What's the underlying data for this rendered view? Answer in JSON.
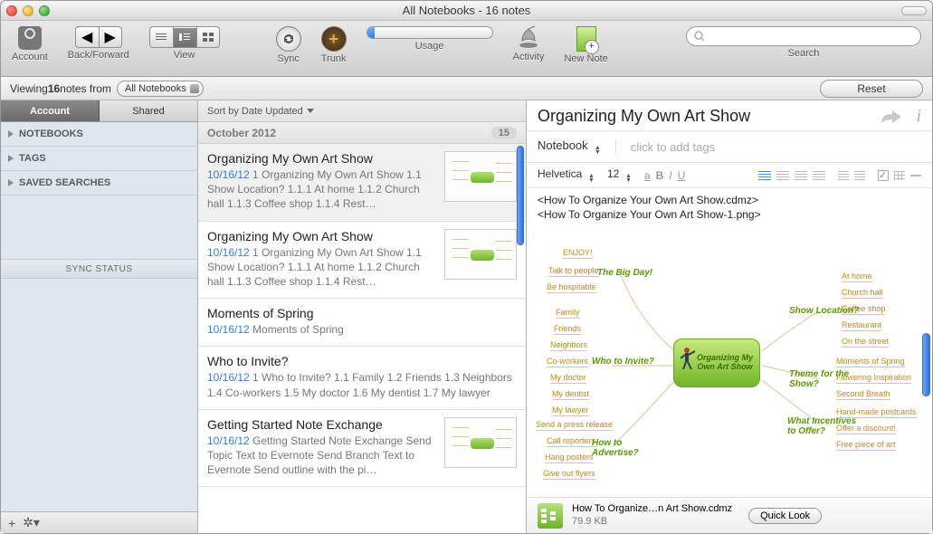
{
  "window": {
    "title": "All Notebooks - 16 notes"
  },
  "toolbar": {
    "account": "Account",
    "backforward": "Back/Forward",
    "view": "View",
    "sync": "Sync",
    "trunk": "Trunk",
    "usage": "Usage",
    "activity": "Activity",
    "newnote": "New Note",
    "search": "Search"
  },
  "filter": {
    "prefix": "Viewing ",
    "count": "16",
    "mid": " notes from ",
    "combo": "All Notebooks",
    "reset": "Reset"
  },
  "sidebar": {
    "tab_account": "Account",
    "tab_shared": "Shared",
    "sections": [
      "NOTEBOOKS",
      "TAGS",
      "SAVED SEARCHES"
    ],
    "sync_status": "SYNC STATUS"
  },
  "list": {
    "sort": "Sort by Date Updated",
    "month": "October 2012",
    "month_count": "15",
    "items": [
      {
        "title": "Organizing My Own Art Show",
        "date": "10/16/12",
        "snippet": "1 Organizing My Own Art Show 1.1 Show Location? 1.1.1 At home 1.1.2 Church hall 1.1.3 Coffee shop 1.1.4 Rest…",
        "thumb": true
      },
      {
        "title": "Organizing My Own Art Show",
        "date": "10/16/12",
        "snippet": "1 Organizing My Own Art Show 1.1 Show Location? 1.1.1 At home 1.1.2 Church hall 1.1.3 Coffee shop 1.1.4 Rest…",
        "thumb": true
      },
      {
        "title": "Moments of Spring",
        "date": "10/16/12",
        "snippet": "Moments of Spring",
        "thumb": false
      },
      {
        "title": "Who to Invite?",
        "date": "10/16/12",
        "snippet": "1 Who to Invite? 1.1 Family 1.2 Friends 1.3 Neighbors 1.4 Co-workers 1.5 My doctor 1.6 My dentist 1.7 My lawyer",
        "thumb": false
      },
      {
        "title": "Getting Started Note Exchange",
        "date": "10/16/12",
        "snippet": "Getting Started Note Exchange Send Topic Text to Evernote Send Branch Text to Evernote Send outline with the pi…",
        "thumb": true
      }
    ]
  },
  "note": {
    "title": "Organizing My Own Art Show",
    "notebook_label": "Notebook",
    "tags_placeholder": "click to add tags",
    "font": "Helvetica",
    "size": "12",
    "file1": "<How To Organize Your Own Art Show.cdmz>",
    "file2": "<How To Organize Your Own Art Show-1.png>",
    "mindmap": {
      "center": "Organizing My Own Art Show",
      "branches": {
        "bigday": {
          "label": "The Big Day!",
          "leaves": [
            "ENJOY!",
            "Talk to people",
            "Be hospitable"
          ]
        },
        "invite": {
          "label": "Who to Invite?",
          "leaves": [
            "Family",
            "Friends",
            "Neighbors",
            "Co-workers",
            "My doctor",
            "My dentist",
            "My lawyer"
          ]
        },
        "advertise": {
          "label": "How to Advertise?",
          "leaves": [
            "Send a press release",
            "Call reporters",
            "Hang posters",
            "Give out flyers"
          ]
        },
        "location": {
          "label": "Show Location?",
          "leaves": [
            "At home",
            "Church hall",
            "Coffee shop",
            "Restaurant",
            "On the street"
          ]
        },
        "theme": {
          "label": "Theme for the Show?",
          "leaves": [
            "Moments of Spring",
            "Flowering Inspiration",
            "Second Breath"
          ]
        },
        "incentives": {
          "label": "What Incentives to Offer?",
          "leaves": [
            "Hand-made postcards",
            "Offer a discount!",
            "Free piece of art"
          ]
        }
      }
    },
    "attachment": {
      "name": "How To Organize…n Art Show.cdmz",
      "size": "79.9 KB",
      "quicklook": "Quick Look"
    }
  }
}
